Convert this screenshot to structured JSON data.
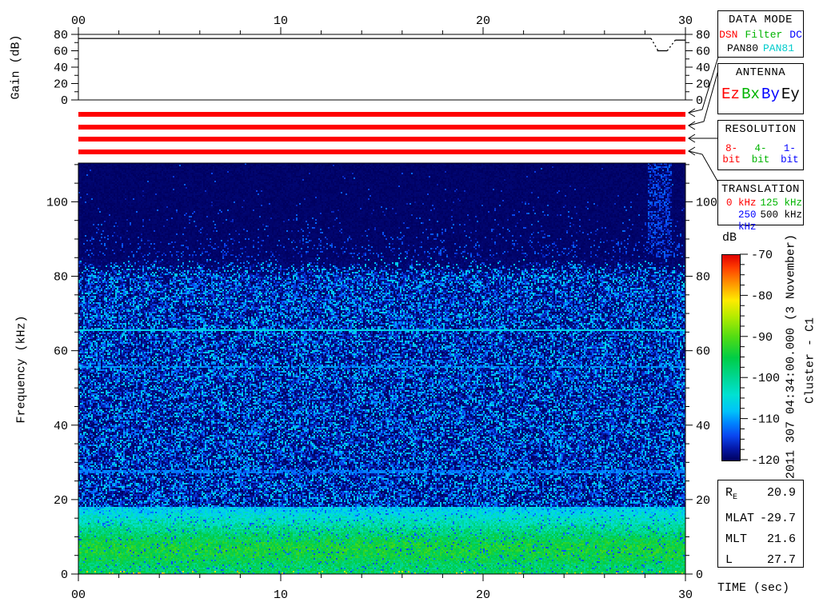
{
  "labels": {
    "gain_axis": "Gain (dB)",
    "freq_axis": "Frequency (kHz)",
    "time_axis": "TIME (sec)",
    "colorbar_unit": "dB",
    "timestamp_vertical": "2011 307 04:34:00.000 (3 November)",
    "spacecraft_vertical": "Cluster - C1"
  },
  "boxes": {
    "data_mode": {
      "title": "DATA MODE",
      "row1": [
        {
          "text": "DSN",
          "color": "#ff0000"
        },
        {
          "text": "Filter",
          "color": "#00b400"
        },
        {
          "text": "DC",
          "color": "#0000ff"
        }
      ],
      "row2": [
        {
          "text": "PAN80",
          "color": "#000000"
        },
        {
          "text": "PAN81",
          "color": "#00cccc"
        }
      ]
    },
    "antenna": {
      "title": "ANTENNA",
      "row": [
        {
          "text": "Ez",
          "color": "#ff0000"
        },
        {
          "text": "Bx",
          "color": "#00b400"
        },
        {
          "text": "By",
          "color": "#0000ff"
        },
        {
          "text": "Ey",
          "color": "#000000"
        }
      ]
    },
    "resolution": {
      "title": "RESOLUTION",
      "row": [
        {
          "text": "8-bit",
          "color": "#ff0000"
        },
        {
          "text": "4-bit",
          "color": "#00b400"
        },
        {
          "text": "1-bit",
          "color": "#0000ff"
        }
      ]
    },
    "translation": {
      "title": "TRANSLATION",
      "rows": [
        [
          {
            "text": "0 kHz",
            "color": "#ff0000"
          },
          {
            "text": "125 kHz",
            "color": "#00b400"
          }
        ],
        [
          {
            "text": "250 kHz",
            "color": "#0000ff"
          },
          {
            "text": "500 kHz",
            "color": "#000000"
          }
        ]
      ]
    }
  },
  "info_box": {
    "rows": [
      {
        "label": "R",
        "sub": "E",
        "value": "20.9"
      },
      {
        "label": "MLAT",
        "value": "-29.7"
      },
      {
        "label": "MLT",
        "value": "21.6"
      },
      {
        "label": "L",
        "value": "27.7"
      }
    ]
  },
  "chart_data": [
    {
      "type": "line",
      "name": "agc-gain-panel",
      "ylabel": "Gain (dB)",
      "xlim": [
        0,
        30
      ],
      "ylim": [
        0,
        80
      ],
      "x_major": [
        0,
        10,
        20,
        30
      ],
      "x_tick_labels": [
        "00",
        "10",
        "20",
        "30"
      ],
      "x_minor_step": 2,
      "y_major": [
        0,
        20,
        40,
        60,
        80
      ],
      "y_minor": [
        10,
        30,
        50,
        70
      ],
      "line_color": "#000000",
      "segments": [
        {
          "style": "solid",
          "points": [
            [
              0,
              75
            ],
            [
              28.3,
              75
            ]
          ]
        },
        {
          "style": "dotted",
          "points": [
            [
              28.3,
              75
            ],
            [
              28.65,
              60
            ]
          ]
        },
        {
          "style": "solid",
          "points": [
            [
              28.6,
              60
            ],
            [
              29.1,
              60
            ]
          ]
        },
        {
          "style": "dotted",
          "points": [
            [
              29.1,
              60
            ],
            [
              29.5,
              73
            ]
          ]
        },
        {
          "style": "solid",
          "points": [
            [
              29.5,
              73
            ],
            [
              30,
              73
            ]
          ]
        }
      ]
    },
    {
      "type": "status-bars",
      "name": "mode-status-stripes",
      "color": "#ff0000",
      "xlim": [
        0,
        30
      ],
      "rows": [
        {
          "label": "DATA MODE",
          "t_start": 0,
          "t_end": 30
        },
        {
          "label": "ANTENNA",
          "t_start": 0,
          "t_end": 30
        },
        {
          "label": "RESOLUTION",
          "t_start": 0,
          "t_end": 30
        },
        {
          "label": "TRANSLATION",
          "t_start": 0,
          "t_end": 30
        }
      ]
    },
    {
      "type": "heatmap",
      "name": "wbd-spectrogram",
      "xlabel": "TIME (sec)",
      "ylabel": "Frequency (kHz)",
      "xlim": [
        0,
        30
      ],
      "ylim": [
        0,
        110
      ],
      "x_major": [
        0,
        10,
        20,
        30
      ],
      "x_tick_labels": [
        "00",
        "10",
        "20",
        "30"
      ],
      "x_minor_step": 2,
      "y_major": [
        0,
        20,
        40,
        60,
        80,
        100
      ],
      "y_minor_step": 5,
      "colorbar": {
        "unit": "dB",
        "range": [
          -120,
          -70
        ],
        "major_ticks": [
          -70,
          -80,
          -90,
          -100,
          -110,
          -120
        ],
        "minor_step": 2.5
      },
      "colormap_stops": [
        [
          0.0,
          "#e00000"
        ],
        [
          0.06,
          "#ff3c00"
        ],
        [
          0.14,
          "#ff9600"
        ],
        [
          0.22,
          "#ffeb00"
        ],
        [
          0.3,
          "#b4eb00"
        ],
        [
          0.4,
          "#50dc14"
        ],
        [
          0.5,
          "#00cd46"
        ],
        [
          0.6,
          "#00d796"
        ],
        [
          0.68,
          "#00e1d2"
        ],
        [
          0.76,
          "#00c3fa"
        ],
        [
          0.82,
          "#0082ff"
        ],
        [
          0.88,
          "#0a46f0"
        ],
        [
          0.94,
          "#0519aa"
        ],
        [
          1.0,
          "#00005f"
        ]
      ],
      "features": {
        "background_floor_db": -120,
        "broadband_noise": {
          "f_low_khz": 18,
          "f_high_khz": 85,
          "db_min": -120,
          "db_max": -105
        },
        "sparse_top": {
          "f_above_khz": 85,
          "speckle_db": -116,
          "decay_khz": 7
        },
        "emission_lines": [
          {
            "f_khz": 65.6,
            "db": -105,
            "coverage": 1.0
          },
          {
            "f_khz": 55.5,
            "db": -109,
            "coverage": 0.8
          },
          {
            "f_khz": 27.5,
            "db": -110,
            "coverage": 0.75
          }
        ],
        "low_band_profile": [
          [
            0,
            -96
          ],
          [
            1,
            -97
          ],
          [
            2,
            -97.5
          ],
          [
            4,
            -95.5
          ],
          [
            6,
            -94
          ],
          [
            8,
            -94.5
          ],
          [
            10,
            -97
          ],
          [
            12,
            -99.5
          ],
          [
            15,
            -103.5
          ],
          [
            18,
            -107.5
          ]
        ],
        "dc_hot_dots": {
          "f_below_khz": 0.9,
          "db": -78,
          "probability": 0.06
        },
        "right_burst": {
          "t_start": 28.1,
          "t_end": 29.25,
          "f_above_khz": 84
        }
      }
    }
  ]
}
